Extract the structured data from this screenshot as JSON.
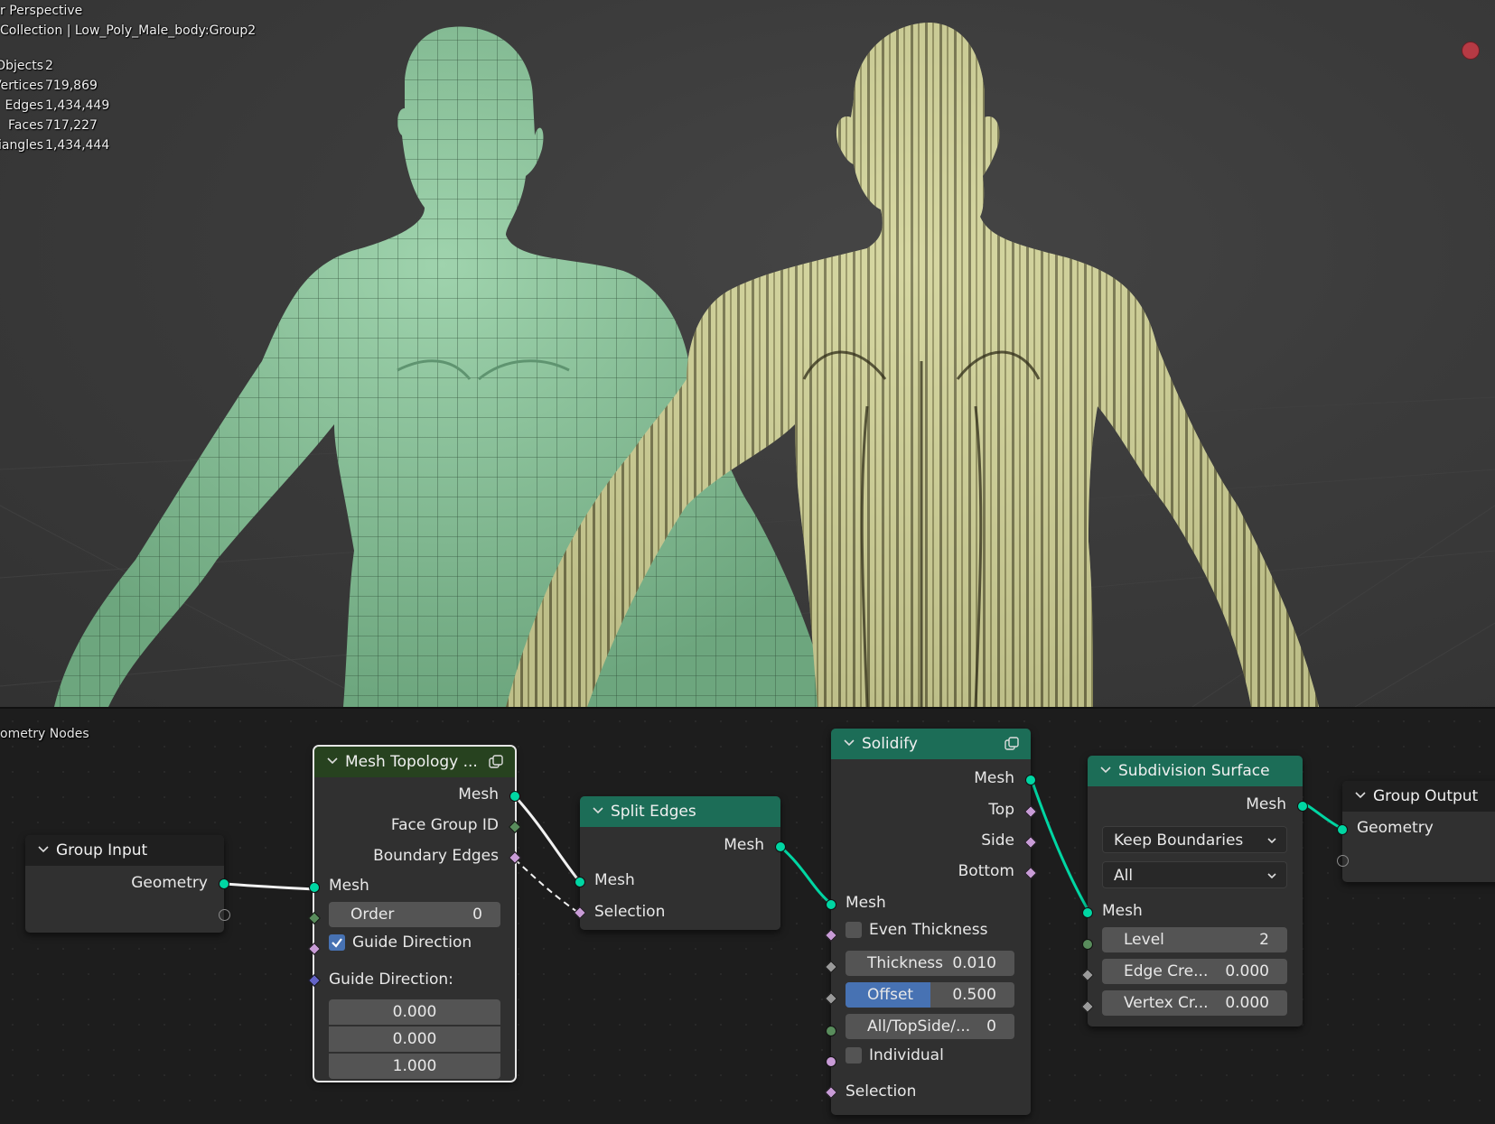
{
  "viewport": {
    "view_name": "r Perspective",
    "collection_path": "Collection | Low_Poly_Male_body:Group2",
    "stats": [
      {
        "label": "Objects",
        "value": "2"
      },
      {
        "label": "Vertices",
        "value": "719,869"
      },
      {
        "label": "Edges",
        "value": "1,434,449"
      },
      {
        "label": "Faces",
        "value": "717,227"
      },
      {
        "label": "Triangles",
        "value": "1,434,444"
      }
    ],
    "colors": {
      "green_mesh": "#8fc79f",
      "yellow_mesh": "#d2d39c",
      "record_dot": "#b63a44"
    }
  },
  "node_editor": {
    "label": "ometry Nodes",
    "group_input": {
      "title": "Group Input",
      "out_geometry": "Geometry"
    },
    "mesh_topology": {
      "title": "Mesh Topology ...",
      "out_mesh": "Mesh",
      "out_face_group_id": "Face Group ID",
      "out_boundary_edges": "Boundary Edges",
      "in_mesh": "Mesh",
      "order_label": "Order",
      "order_value": "0",
      "guide_direction_checkbox": "Guide Direction",
      "guide_direction_vector_label": "Guide Direction:",
      "vector": [
        "0.000",
        "0.000",
        "1.000"
      ]
    },
    "split_edges": {
      "title": "Split Edges",
      "out_mesh": "Mesh",
      "in_mesh": "Mesh",
      "in_selection": "Selection"
    },
    "solidify": {
      "title": "Solidify",
      "out_mesh": "Mesh",
      "out_top": "Top",
      "out_side": "Side",
      "out_bottom": "Bottom",
      "in_mesh": "Mesh",
      "even_thickness": "Even Thickness",
      "thickness_label": "Thickness",
      "thickness_value": "0.010",
      "offset_label": "Offset",
      "offset_value": "0.500",
      "offset_fill": 0.5,
      "all_top_side_label": "All/TopSide/...",
      "all_top_side_value": "0",
      "individual": "Individual",
      "in_selection": "Selection"
    },
    "subdivision_surface": {
      "title": "Subdivision Surface",
      "out_mesh": "Mesh",
      "boundary_mode": "Keep Boundaries",
      "uv_mode": "All",
      "in_mesh": "Mesh",
      "level_label": "Level",
      "level_value": "2",
      "edge_crease_label": "Edge Cre...",
      "edge_crease_value": "0.000",
      "vertex_crease_label": "Vertex Cr...",
      "vertex_crease_value": "0.000"
    },
    "group_output": {
      "title": "Group Output",
      "in_geometry": "Geometry"
    },
    "colors": {
      "geometry_socket": "#00d6a3",
      "field_socket": "#c89bd6",
      "vector_socket": "#6363c7",
      "int_socket": "#598c5c",
      "header_green": "#1c6d57",
      "header_olive": "#27421f",
      "header_dark": "#1f1f1f"
    }
  }
}
